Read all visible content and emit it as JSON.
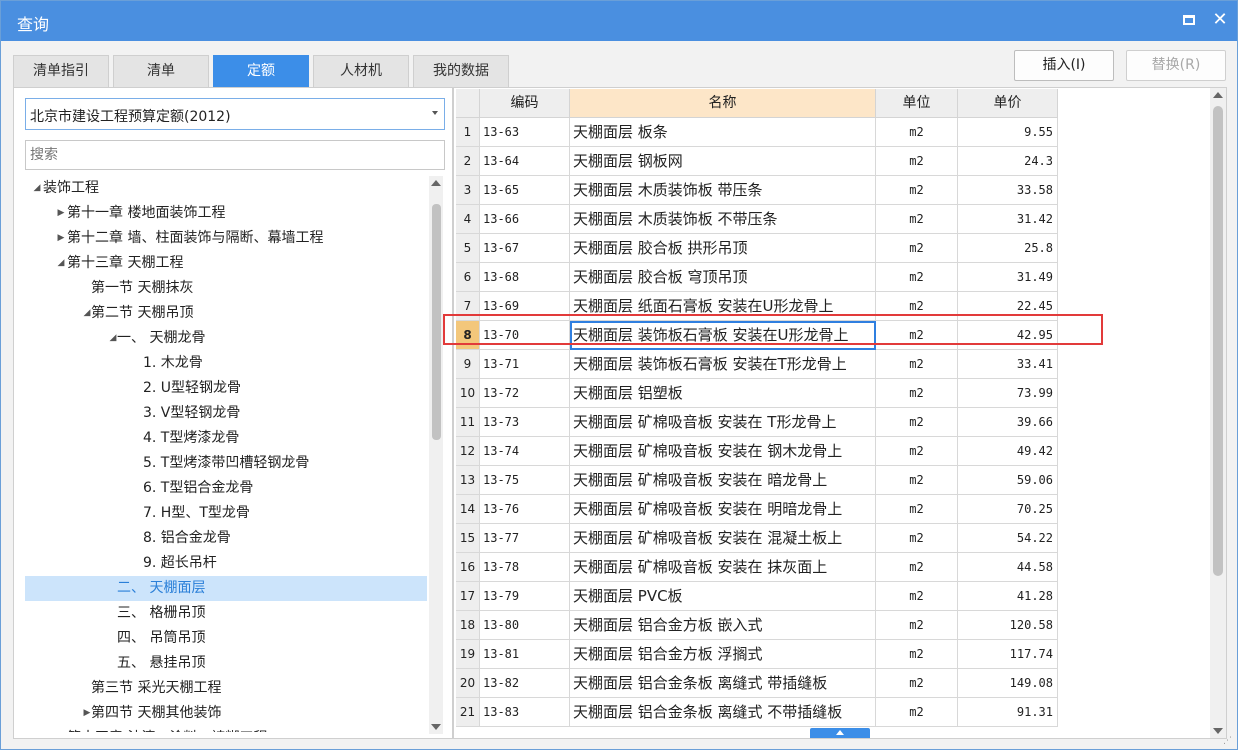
{
  "window": {
    "title": "查询"
  },
  "tabs": [
    {
      "label": "清单指引",
      "active": false
    },
    {
      "label": "清单",
      "active": false
    },
    {
      "label": "定额",
      "active": true
    },
    {
      "label": "人材机",
      "active": false
    },
    {
      "label": "我的数据",
      "active": false
    }
  ],
  "buttons": {
    "insert": "插入(I)",
    "replace": "替换(R)"
  },
  "left": {
    "dropdown_value": "北京市建设工程预算定额(2012)",
    "search_placeholder": "搜索",
    "tree": [
      {
        "label": "装饰工程",
        "level": 0,
        "arrow": "expanded"
      },
      {
        "label": "第十一章 楼地面装饰工程",
        "level": 1,
        "arrow": "collapsed"
      },
      {
        "label": "第十二章 墙、柱面装饰与隔断、幕墙工程",
        "level": 1,
        "arrow": "collapsed"
      },
      {
        "label": "第十三章 天棚工程",
        "level": 1,
        "arrow": "expanded"
      },
      {
        "label": "第一节 天棚抹灰",
        "level": 2,
        "arrow": "none"
      },
      {
        "label": "第二节 天棚吊顶",
        "level": 2,
        "arrow": "expanded"
      },
      {
        "label": "一、 天棚龙骨",
        "level": 3,
        "arrow": "expanded"
      },
      {
        "label": "1. 木龙骨",
        "level": 4,
        "arrow": "none"
      },
      {
        "label": "2. U型轻钢龙骨",
        "level": 4,
        "arrow": "none"
      },
      {
        "label": "3. V型轻钢龙骨",
        "level": 4,
        "arrow": "none"
      },
      {
        "label": "4. T型烤漆龙骨",
        "level": 4,
        "arrow": "none"
      },
      {
        "label": "5. T型烤漆带凹槽轻钢龙骨",
        "level": 4,
        "arrow": "none"
      },
      {
        "label": "6. T型铝合金龙骨",
        "level": 4,
        "arrow": "none"
      },
      {
        "label": "7. H型、T型龙骨",
        "level": 4,
        "arrow": "none"
      },
      {
        "label": "8. 铝合金龙骨",
        "level": 4,
        "arrow": "none"
      },
      {
        "label": "9. 超长吊杆",
        "level": 4,
        "arrow": "none"
      },
      {
        "label": "二、 天棚面层",
        "level": 3,
        "arrow": "none",
        "selected": true
      },
      {
        "label": "三、 格栅吊顶",
        "level": 3,
        "arrow": "none"
      },
      {
        "label": "四、 吊筒吊顶",
        "level": 3,
        "arrow": "none"
      },
      {
        "label": "五、 悬挂吊顶",
        "level": 3,
        "arrow": "none"
      },
      {
        "label": "第三节 采光天棚工程",
        "level": 2,
        "arrow": "none"
      },
      {
        "label": "第四节 天棚其他装饰",
        "level": 2,
        "arrow": "collapsed"
      },
      {
        "label": "第十四章 油漆、涂料、裱糊工程",
        "level": 1,
        "arrow": "collapsed"
      }
    ]
  },
  "table": {
    "headers": {
      "code": "编码",
      "name": "名称",
      "unit": "单位",
      "price": "单价"
    },
    "rows": [
      {
        "idx": "1",
        "code": "13-63",
        "name": "天棚面层 板条",
        "unit": "m2",
        "price": "9.55"
      },
      {
        "idx": "2",
        "code": "13-64",
        "name": "天棚面层 钢板网",
        "unit": "m2",
        "price": "24.3"
      },
      {
        "idx": "3",
        "code": "13-65",
        "name": "天棚面层 木质装饰板 带压条",
        "unit": "m2",
        "price": "33.58"
      },
      {
        "idx": "4",
        "code": "13-66",
        "name": "天棚面层 木质装饰板 不带压条",
        "unit": "m2",
        "price": "31.42"
      },
      {
        "idx": "5",
        "code": "13-67",
        "name": "天棚面层 胶合板 拱形吊顶",
        "unit": "m2",
        "price": "25.8"
      },
      {
        "idx": "6",
        "code": "13-68",
        "name": "天棚面层 胶合板 穹顶吊顶",
        "unit": "m2",
        "price": "31.49"
      },
      {
        "idx": "7",
        "code": "13-69",
        "name": "天棚面层 纸面石膏板 安装在U形龙骨上",
        "unit": "m2",
        "price": "22.45"
      },
      {
        "idx": "8",
        "code": "13-70",
        "name": "天棚面层 装饰板石膏板 安装在U形龙骨上",
        "unit": "m2",
        "price": "42.95",
        "current": true
      },
      {
        "idx": "9",
        "code": "13-71",
        "name": "天棚面层 装饰板石膏板 安装在T形龙骨上",
        "unit": "m2",
        "price": "33.41"
      },
      {
        "idx": "10",
        "code": "13-72",
        "name": "天棚面层 铝塑板",
        "unit": "m2",
        "price": "73.99"
      },
      {
        "idx": "11",
        "code": "13-73",
        "name": "天棚面层 矿棉吸音板 安装在 T形龙骨上",
        "unit": "m2",
        "price": "39.66"
      },
      {
        "idx": "12",
        "code": "13-74",
        "name": "天棚面层 矿棉吸音板 安装在 钢木龙骨上",
        "unit": "m2",
        "price": "49.42"
      },
      {
        "idx": "13",
        "code": "13-75",
        "name": "天棚面层 矿棉吸音板 安装在 暗龙骨上",
        "unit": "m2",
        "price": "59.06"
      },
      {
        "idx": "14",
        "code": "13-76",
        "name": "天棚面层 矿棉吸音板 安装在 明暗龙骨上",
        "unit": "m2",
        "price": "70.25"
      },
      {
        "idx": "15",
        "code": "13-77",
        "name": "天棚面层 矿棉吸音板 安装在 混凝土板上",
        "unit": "m2",
        "price": "54.22"
      },
      {
        "idx": "16",
        "code": "13-78",
        "name": "天棚面层 矿棉吸音板 安装在 抹灰面上",
        "unit": "m2",
        "price": "44.58"
      },
      {
        "idx": "17",
        "code": "13-79",
        "name": "天棚面层 PVC板",
        "unit": "m2",
        "price": "41.28"
      },
      {
        "idx": "18",
        "code": "13-80",
        "name": "天棚面层 铝合金方板 嵌入式",
        "unit": "m2",
        "price": "120.58"
      },
      {
        "idx": "19",
        "code": "13-81",
        "name": "天棚面层 铝合金方板 浮搁式",
        "unit": "m2",
        "price": "117.74"
      },
      {
        "idx": "20",
        "code": "13-82",
        "name": "天棚面层 铝合金条板 离缝式 带插缝板",
        "unit": "m2",
        "price": "149.08"
      },
      {
        "idx": "21",
        "code": "13-83",
        "name": "天棚面层 铝合金条板 离缝式 不带插缝板",
        "unit": "m2",
        "price": "91.31"
      }
    ]
  },
  "colors": {
    "titlebar": "#4a8fe0",
    "active_tab": "#3c8ee8",
    "highlight_box": "#e23a3a",
    "name_header": "#fde6c8"
  }
}
